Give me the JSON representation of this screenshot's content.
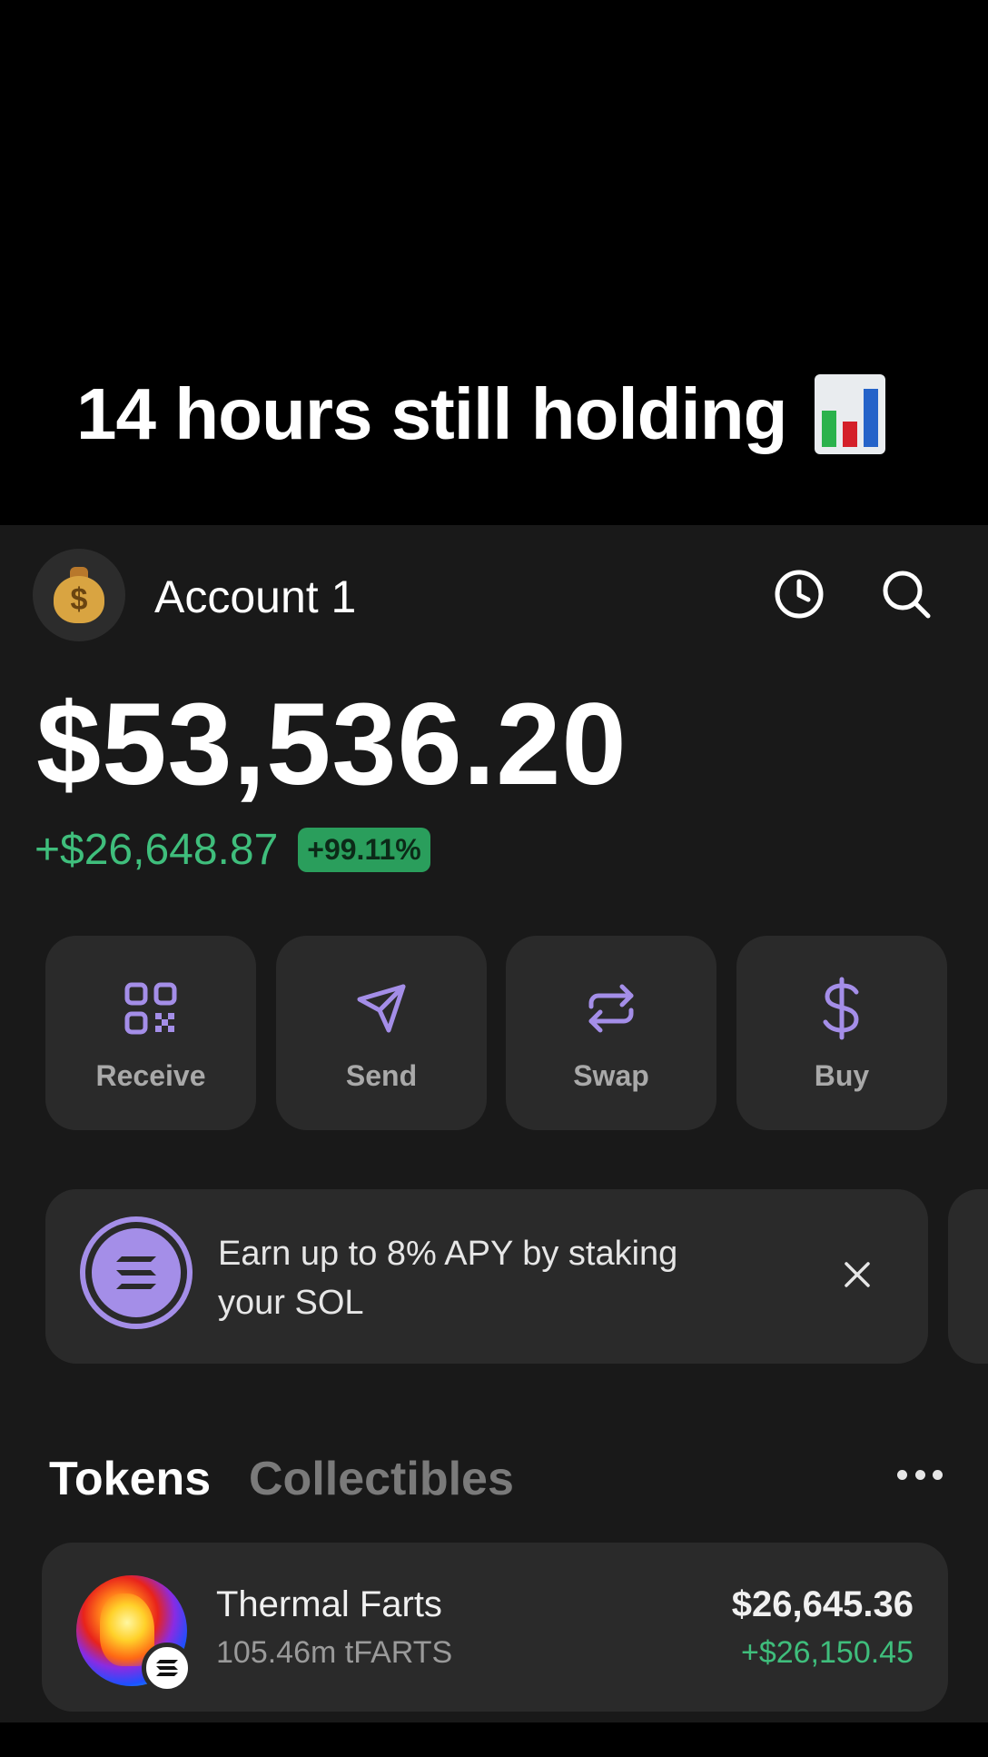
{
  "caption": {
    "text": "14 hours still holding",
    "emoji": "bar-chart-emoji"
  },
  "header": {
    "account_name": "Account 1",
    "avatar_icon": "money-bag-icon",
    "history_icon": "clock-icon",
    "search_icon": "search-icon"
  },
  "balance": {
    "total": "$53,536.20",
    "change": "+$26,648.87",
    "change_percent": "+99.11%"
  },
  "actions": [
    {
      "label": "Receive",
      "icon": "qr-code-icon"
    },
    {
      "label": "Send",
      "icon": "send-icon"
    },
    {
      "label": "Swap",
      "icon": "swap-icon"
    },
    {
      "label": "Buy",
      "icon": "dollar-icon"
    }
  ],
  "promo": {
    "text_line1": "Earn up to 8% APY by staking",
    "text_line2": "your SOL",
    "icon": "solana-icon"
  },
  "tabs": {
    "tokens": "Tokens",
    "collectibles": "Collectibles"
  },
  "tokens": [
    {
      "name": "Thermal Farts",
      "amount": "105.46m tFARTS",
      "value": "$26,645.36",
      "change": "+$26,150.45"
    }
  ],
  "colors": {
    "accent": "#a48ee8",
    "positive": "#3fbe7c",
    "background": "#191919",
    "card": "#2a2a2a"
  }
}
